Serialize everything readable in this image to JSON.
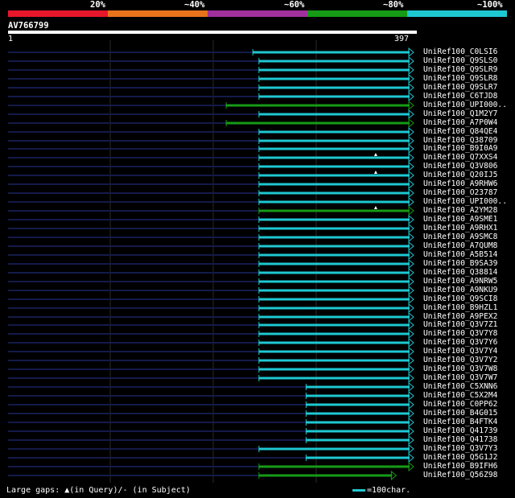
{
  "legend": {
    "percent_labels": [
      "20%",
      "~40%",
      "~60%",
      "~80%",
      "~100%"
    ],
    "colors": [
      "#e6162b",
      "#e8731c",
      "#a0309b",
      "#169b16",
      "#1ec8d2"
    ]
  },
  "query": {
    "name": "AV766799",
    "start_label": "1",
    "end_label": "397",
    "length": 397
  },
  "hits": [
    {
      "label": "UniRef100_C0LSI6",
      "start": 240,
      "end": 397,
      "color": "#1ec8d2",
      "gap_marks": []
    },
    {
      "label": "UniRef100_Q9SLS0",
      "start": 246,
      "end": 397,
      "color": "#1ec8d2",
      "gap_marks": []
    },
    {
      "label": "UniRef100_Q9SLR9",
      "start": 246,
      "end": 397,
      "color": "#1ec8d2",
      "gap_marks": []
    },
    {
      "label": "UniRef100_Q9SLR8",
      "start": 246,
      "end": 397,
      "color": "#1ec8d2",
      "gap_marks": []
    },
    {
      "label": "UniRef100_Q9SLR7",
      "start": 246,
      "end": 397,
      "color": "#1ec8d2",
      "gap_marks": []
    },
    {
      "label": "UniRef100_C6TJD8",
      "start": 246,
      "end": 397,
      "color": "#1ec8d2",
      "gap_marks": []
    },
    {
      "label": "UniRef100_UPI000..",
      "start": 214,
      "end": 397,
      "color": "#169b16",
      "gap_marks": []
    },
    {
      "label": "UniRef100_Q1M2Y7",
      "start": 246,
      "end": 397,
      "color": "#1ec8d2",
      "gap_marks": []
    },
    {
      "label": "UniRef100_A7P0W4",
      "start": 214,
      "end": 397,
      "color": "#169b16",
      "gap_marks": []
    },
    {
      "label": "UniRef100_Q84QE4",
      "start": 246,
      "end": 397,
      "color": "#1ec8d2",
      "gap_marks": []
    },
    {
      "label": "UniRef100_Q38709",
      "start": 246,
      "end": 397,
      "color": "#1ec8d2",
      "gap_marks": []
    },
    {
      "label": "UniRef100_B9I0A9",
      "start": 246,
      "end": 397,
      "color": "#1ec8d2",
      "gap_marks": []
    },
    {
      "label": "UniRef100_Q7XXS4",
      "start": 246,
      "end": 397,
      "color": "#1ec8d2",
      "gap_marks": [
        360
      ]
    },
    {
      "label": "UniRef100_Q3V806",
      "start": 246,
      "end": 397,
      "color": "#1ec8d2",
      "gap_marks": []
    },
    {
      "label": "UniRef100_Q20IJ5",
      "start": 246,
      "end": 397,
      "color": "#1ec8d2",
      "gap_marks": [
        360
      ]
    },
    {
      "label": "UniRef100_A9RHW6",
      "start": 246,
      "end": 397,
      "color": "#1ec8d2",
      "gap_marks": []
    },
    {
      "label": "UniRef100_O23787",
      "start": 246,
      "end": 397,
      "color": "#1ec8d2",
      "gap_marks": []
    },
    {
      "label": "UniRef100_UPI000..",
      "start": 246,
      "end": 397,
      "color": "#1ec8d2",
      "gap_marks": []
    },
    {
      "label": "UniRef100_A2YM28",
      "start": 246,
      "end": 397,
      "color": "#169b16",
      "gap_marks": [
        360
      ]
    },
    {
      "label": "UniRef100_A9SME1",
      "start": 246,
      "end": 397,
      "color": "#1ec8d2",
      "gap_marks": []
    },
    {
      "label": "UniRef100_A9RHX1",
      "start": 246,
      "end": 397,
      "color": "#1ec8d2",
      "gap_marks": []
    },
    {
      "label": "UniRef100_A9SMC8",
      "start": 246,
      "end": 397,
      "color": "#1ec8d2",
      "gap_marks": []
    },
    {
      "label": "UniRef100_A7QUM8",
      "start": 246,
      "end": 397,
      "color": "#1ec8d2",
      "gap_marks": []
    },
    {
      "label": "UniRef100_A5B514",
      "start": 246,
      "end": 397,
      "color": "#1ec8d2",
      "gap_marks": []
    },
    {
      "label": "UniRef100_B9SA39",
      "start": 246,
      "end": 397,
      "color": "#1ec8d2",
      "gap_marks": []
    },
    {
      "label": "UniRef100_Q38814",
      "start": 246,
      "end": 397,
      "color": "#1ec8d2",
      "gap_marks": []
    },
    {
      "label": "UniRef100_A9NRW5",
      "start": 246,
      "end": 397,
      "color": "#1ec8d2",
      "gap_marks": []
    },
    {
      "label": "UniRef100_A9NKU9",
      "start": 246,
      "end": 397,
      "color": "#1ec8d2",
      "gap_marks": []
    },
    {
      "label": "UniRef100_Q9SCI8",
      "start": 246,
      "end": 397,
      "color": "#1ec8d2",
      "gap_marks": []
    },
    {
      "label": "UniRef100_B9HZL1",
      "start": 246,
      "end": 397,
      "color": "#1ec8d2",
      "gap_marks": []
    },
    {
      "label": "UniRef100_A9PEX2",
      "start": 246,
      "end": 397,
      "color": "#1ec8d2",
      "gap_marks": []
    },
    {
      "label": "UniRef100_Q3V7Z1",
      "start": 246,
      "end": 397,
      "color": "#1ec8d2",
      "gap_marks": []
    },
    {
      "label": "UniRef100_Q3V7Y8",
      "start": 246,
      "end": 397,
      "color": "#1ec8d2",
      "gap_marks": []
    },
    {
      "label": "UniRef100_Q3V7Y6",
      "start": 246,
      "end": 397,
      "color": "#1ec8d2",
      "gap_marks": []
    },
    {
      "label": "UniRef100_Q3V7Y4",
      "start": 246,
      "end": 397,
      "color": "#1ec8d2",
      "gap_marks": []
    },
    {
      "label": "UniRef100_Q3V7Y2",
      "start": 246,
      "end": 397,
      "color": "#1ec8d2",
      "gap_marks": []
    },
    {
      "label": "UniRef100_Q3V7W8",
      "start": 246,
      "end": 397,
      "color": "#1ec8d2",
      "gap_marks": []
    },
    {
      "label": "UniRef100_Q3V7W7",
      "start": 246,
      "end": 397,
      "color": "#1ec8d2",
      "gap_marks": []
    },
    {
      "label": "UniRef100_C5XNN6",
      "start": 292,
      "end": 397,
      "color": "#1ec8d2",
      "gap_marks": []
    },
    {
      "label": "UniRef100_C5X2M4",
      "start": 292,
      "end": 397,
      "color": "#1ec8d2",
      "gap_marks": []
    },
    {
      "label": "UniRef100_C0PP62",
      "start": 292,
      "end": 397,
      "color": "#1ec8d2",
      "gap_marks": []
    },
    {
      "label": "UniRef100_B4G015",
      "start": 292,
      "end": 397,
      "color": "#1ec8d2",
      "gap_marks": []
    },
    {
      "label": "UniRef100_B4FTK4",
      "start": 292,
      "end": 397,
      "color": "#1ec8d2",
      "gap_marks": []
    },
    {
      "label": "UniRef100_Q41739",
      "start": 292,
      "end": 397,
      "color": "#1ec8d2",
      "gap_marks": []
    },
    {
      "label": "UniRef100_Q41738",
      "start": 292,
      "end": 397,
      "color": "#1ec8d2",
      "gap_marks": []
    },
    {
      "label": "UniRef100_Q3V7Y3",
      "start": 246,
      "end": 397,
      "color": "#1ec8d2",
      "gap_marks": []
    },
    {
      "label": "UniRef100_Q5G1J2",
      "start": 292,
      "end": 397,
      "color": "#1ec8d2",
      "gap_marks": []
    },
    {
      "label": "UniRef100_B9IFH6",
      "start": 246,
      "end": 397,
      "color": "#169b16",
      "gap_marks": []
    },
    {
      "label": "UniRef100_Q56Z98",
      "start": 246,
      "end": 380,
      "color": "#169b16",
      "gap_marks": []
    }
  ],
  "footer": {
    "gaps_text": "Large gaps: ▲(in Query)/- (in Subject)",
    "scale_text": "=100char."
  }
}
